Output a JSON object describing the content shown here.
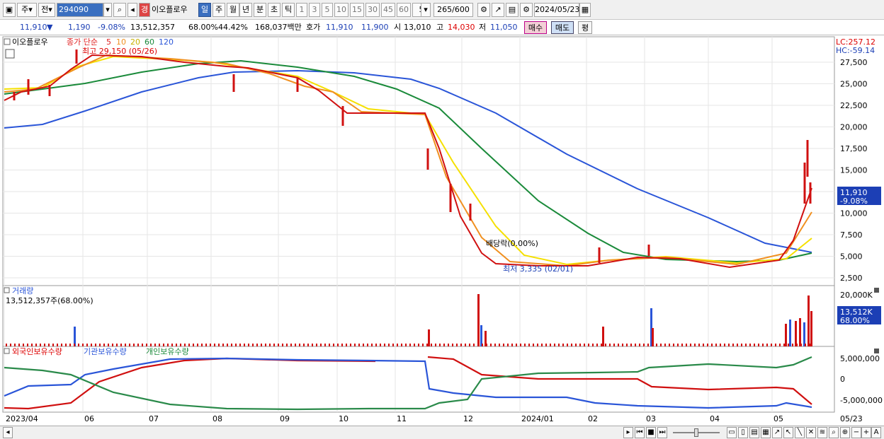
{
  "toolbar": {
    "period_options": [
      "주",
      "전"
    ],
    "stock_code": "294090",
    "stock_name": "이오플로우",
    "badge": "경",
    "period_tabs": [
      "일",
      "주",
      "월",
      "년",
      "분",
      "초",
      "틱"
    ],
    "interval_buttons": [
      "1",
      "3",
      "5",
      "10",
      "15",
      "30",
      "45",
      "60"
    ],
    "interval_select": "5",
    "bar_count": "265/600",
    "date": "2024/05/23"
  },
  "quote": {
    "price": "11,910",
    "direction": "▼",
    "change": "1,190",
    "change_pct": "-9.08%",
    "volume": "13,512,357",
    "volume_ratio": "68.00%",
    "turnover": "44.42%",
    "trade_value": "168,037백만",
    "ask_label": "호가",
    "ask": "11,910",
    "bid": "11,900",
    "open_label": "시",
    "open": "13,010",
    "high_label": "고",
    "high": "14,030",
    "low_label": "저",
    "low": "11,050",
    "buy_button": "매수",
    "sell_button": "매도",
    "extra_button": "평"
  },
  "price_panel": {
    "name": "이오플로우",
    "legend": [
      "종가 단순",
      "5",
      "10",
      "20",
      "60",
      "120"
    ],
    "legend_colors": [
      "#e02020",
      "#e02020",
      "#f09020",
      "#f0d000",
      "#1a8a3a",
      "#2a55d8"
    ],
    "high_note": "최고 29,150 (05/26)",
    "low_note": "최저 3,335 (02/01)",
    "dividend_note": "배당락(0.00%)",
    "lc": "LC:257.12",
    "hc": "HC:-59.14",
    "y_ticks": [
      "27,500",
      "25,000",
      "22,500",
      "20,000",
      "17,500",
      "15,000",
      "12,500",
      "10,000",
      "7,500",
      "5,000",
      "2,500"
    ],
    "current_price": "11,910",
    "current_pct": "-9.08%"
  },
  "volume_panel": {
    "title": "거래량",
    "info": "13,512,357주(68.00%)",
    "y_top": "20,000K",
    "current": "13,512K",
    "current_pct": "68.00%"
  },
  "holding_panel": {
    "legends": [
      "외국인보유수량",
      "기관보유수량",
      "개인보유수량"
    ],
    "legend_colors": [
      "#d00000",
      "#2a55d8",
      "#1a8a3a"
    ],
    "y_ticks": [
      "5,000,000",
      "0",
      "-5,000,000"
    ]
  },
  "x_axis": {
    "labels": [
      "2023/04",
      "06",
      "07",
      "08",
      "09",
      "10",
      "11",
      "12",
      "2024/01",
      "02",
      "03",
      "04",
      "05"
    ],
    "right_label": "05/23"
  },
  "colors": {
    "up": "#e02020",
    "down": "#2a55d8",
    "accent": "#3a6fc0"
  }
}
